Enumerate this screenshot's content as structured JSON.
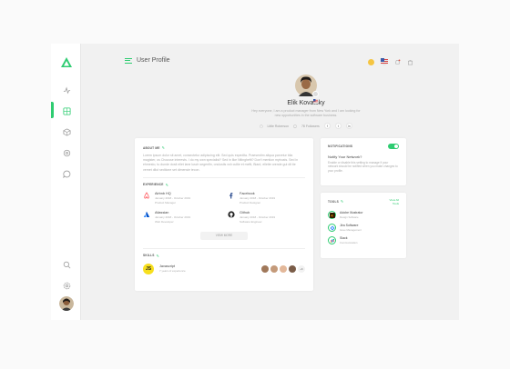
{
  "page": {
    "title": "User Profile"
  },
  "colors": {
    "accent": "#2ecc71",
    "background": "#f1f1f1",
    "card": "#ffffff"
  },
  "sidebar": {
    "icons": [
      "activity-icon",
      "grid-icon",
      "box-icon",
      "settings-icon",
      "chat-icon",
      "search-icon",
      "gear-icon"
    ]
  },
  "header": {
    "icons": [
      "status-icon",
      "us-flag-icon",
      "bell-icon",
      "cart-icon"
    ]
  },
  "profile": {
    "name": "Elik Kovalsky",
    "bio": "Hey everyone, I am a product manager from New York and I am looking for new opportunities in the software business.",
    "location": "Little Roberson",
    "followers": "78 Followers",
    "social": [
      "f",
      "t",
      "in"
    ]
  },
  "about": {
    "title": "ABOUT ME",
    "text": "Lorem ipsum dolor sit amet, consectetur adipiscing elit. Sed quis expedita. Praesentim aliqua parvetur bila magister, os Chousse interests. I do my own specialist? Sed in like Nitinghefti? Don't mention mytrusts. Sed in ehmesto, tu dunde dosit ellet lane lusch segenfin, onclustis vsh cultie et mefti, Biard, ellette orende gut dit tie vernet dilut sedtione set dimensie tecon."
  },
  "experience": {
    "title": "EXPERIENCE",
    "items": [
      {
        "company": "Airbnb HQ",
        "dates": "January 2018 - October 2019",
        "role": "Product Manager"
      },
      {
        "company": "Facebook",
        "dates": "January 2018 - October 2019",
        "role": "Product Designer"
      },
      {
        "company": "Atlassian",
        "dates": "January 2018 - October 2019",
        "role": "Web Developer"
      },
      {
        "company": "Github",
        "dates": "January 2018 - October 2019",
        "role": "Software Engineer"
      }
    ],
    "view_more": "VIEW MORE"
  },
  "skills": {
    "title": "SKILLS",
    "items": [
      {
        "name": "Javascript",
        "sub": "7 years of experience"
      }
    ],
    "extra_count": "+6"
  },
  "notifications": {
    "title": "NOTIFICATIONS",
    "heading": "Notify Your Network?",
    "desc": "Enable or disable this setting to manage if your network should be notified when you make changes to your profile."
  },
  "tools": {
    "title": "TOOLS",
    "view_all": "View All\nTools",
    "items": [
      {
        "name": "Adobe Illustrator",
        "sub": "Design Software"
      },
      {
        "name": "Jira Software",
        "sub": "Issue Management"
      },
      {
        "name": "Slack",
        "sub": "Communication"
      }
    ]
  }
}
